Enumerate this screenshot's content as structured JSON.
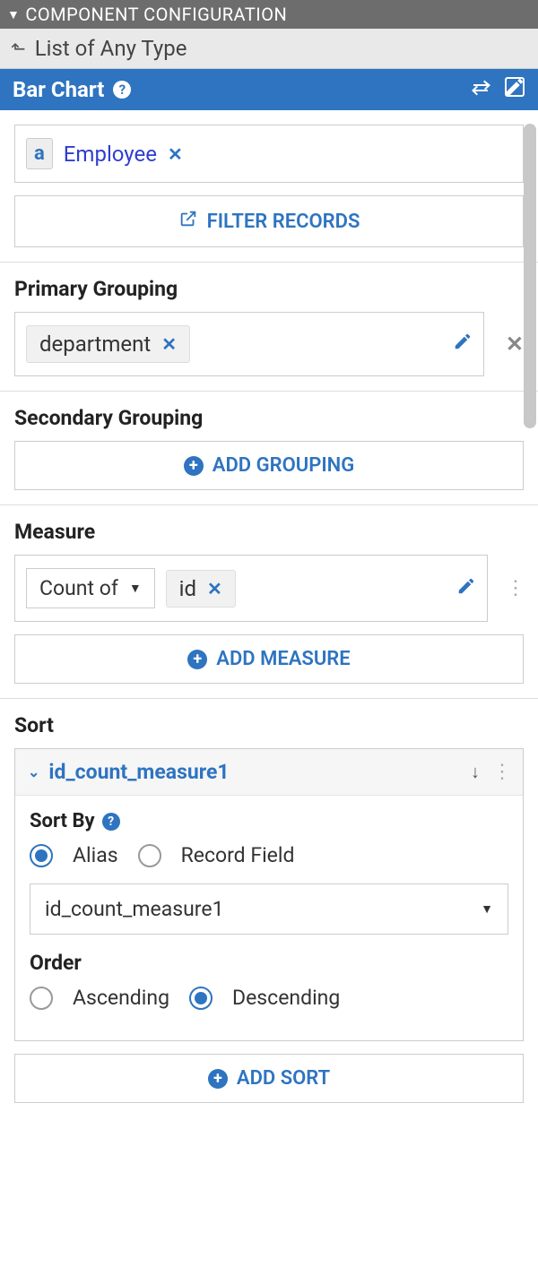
{
  "panel": {
    "title": "COMPONENT CONFIGURATION"
  },
  "breadcrumb": {
    "text": "List of Any Type"
  },
  "component": {
    "name": "Bar Chart"
  },
  "data_source": {
    "chip_label": "Employee"
  },
  "filter": {
    "button": "FILTER RECORDS"
  },
  "primary_grouping": {
    "label": "Primary Grouping",
    "value": "department"
  },
  "secondary_grouping": {
    "label": "Secondary Grouping",
    "button": "ADD GROUPING"
  },
  "measure": {
    "label": "Measure",
    "aggregation": "Count of",
    "field": "id",
    "button": "ADD MEASURE"
  },
  "sort": {
    "label": "Sort",
    "item_name": "id_count_measure1",
    "sort_by_label": "Sort By",
    "alias_label": "Alias",
    "record_field_label": "Record Field",
    "selected_value": "id_count_measure1",
    "order_label": "Order",
    "asc_label": "Ascending",
    "desc_label": "Descending",
    "button": "ADD SORT"
  }
}
